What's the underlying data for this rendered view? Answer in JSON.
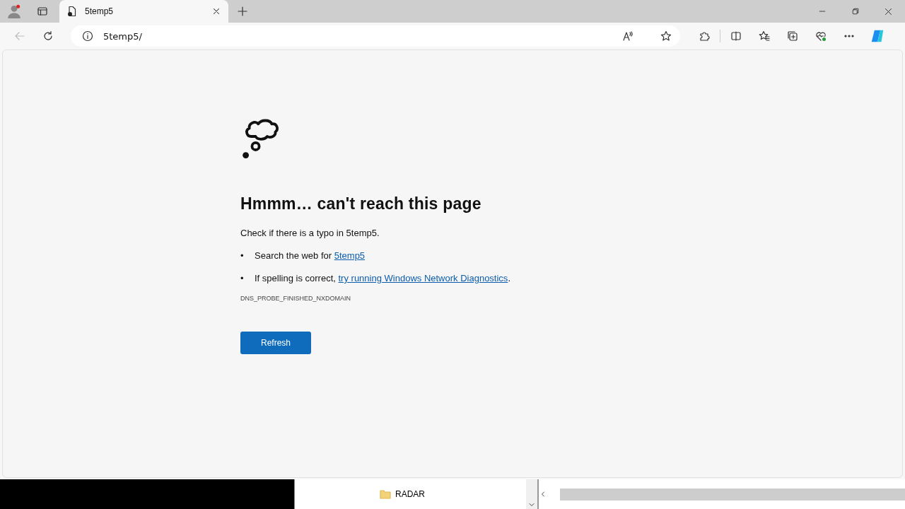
{
  "tab": {
    "title": "5temp5",
    "selected": true
  },
  "address": {
    "value": "5temp5/"
  },
  "error": {
    "heading": "Hmmm… can't reach this page",
    "message": "Check if there is a typo in 5temp5.",
    "suggestions": [
      {
        "bullet": "•",
        "text": "Search the web for ",
        "link": "5temp5"
      },
      {
        "bullet": "•",
        "text": "If spelling is correct, ",
        "link": "try running Windows Network Diagnostics",
        "after": "."
      }
    ],
    "code": "DNS_PROBE_FINISHED_NXDOMAIN",
    "button": "Refresh"
  },
  "background_window": {
    "tree_items": [
      {
        "label": "RADAR"
      }
    ]
  }
}
